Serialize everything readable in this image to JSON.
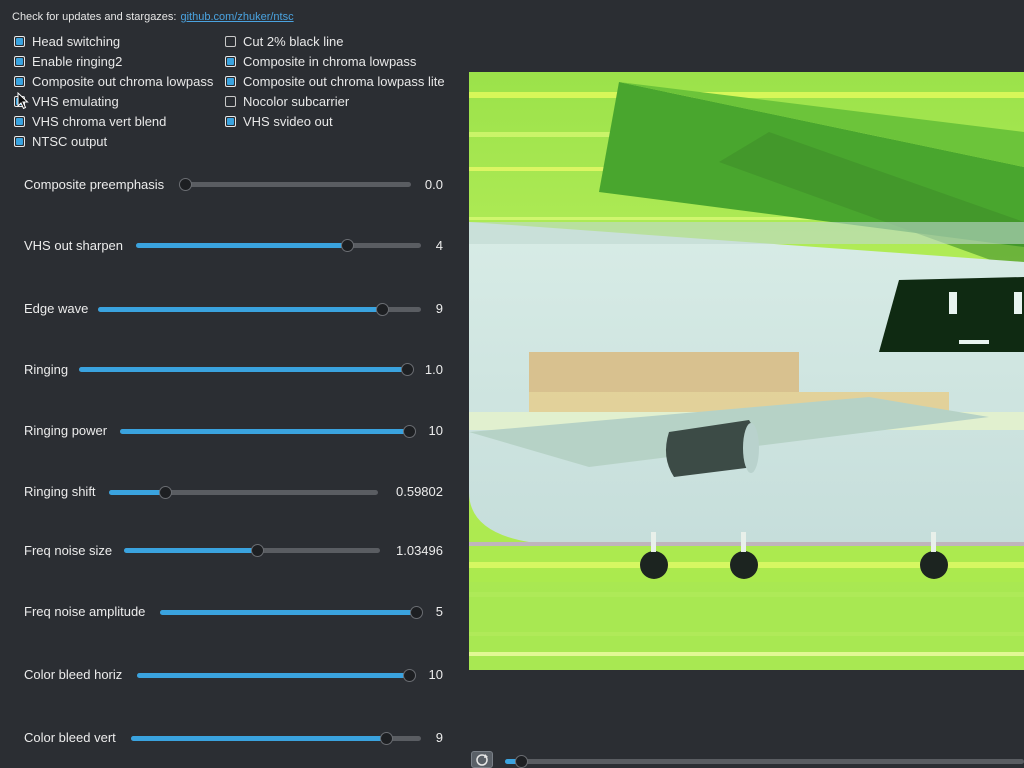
{
  "header": {
    "text": "Check for updates and stargazes:",
    "link": "github.com/zhuker/ntsc"
  },
  "checkboxes": {
    "left": [
      {
        "label": "Head switching",
        "checked": true
      },
      {
        "label": "Enable ringing2",
        "checked": true
      },
      {
        "label": "Composite out chroma lowpass",
        "checked": true
      },
      {
        "label": "VHS emulating",
        "checked": true
      },
      {
        "label": "VHS chroma vert blend",
        "checked": true
      },
      {
        "label": "NTSC output",
        "checked": true
      }
    ],
    "right": [
      {
        "label": "Cut 2% black line",
        "checked": false
      },
      {
        "label": "Composite in chroma lowpass",
        "checked": true
      },
      {
        "label": "Composite out chroma lowpass lite",
        "checked": true
      },
      {
        "label": "Nocolor subcarrier",
        "checked": false
      },
      {
        "label": "VHS svideo out",
        "checked": true
      }
    ]
  },
  "sliders": [
    {
      "label": "Composite preemphasis",
      "value": "0.0",
      "fraction": 0.0
    },
    {
      "label": "VHS out sharpen",
      "value": "4",
      "fraction": 0.74
    },
    {
      "label": "Edge wave",
      "value": "9",
      "fraction": 0.88
    },
    {
      "label": "Ringing",
      "value": "1.0",
      "fraction": 1.0
    },
    {
      "label": "Ringing power",
      "value": "10",
      "fraction": 1.0
    },
    {
      "label": "Ringing shift",
      "value": "0.59802",
      "fraction": 0.21
    },
    {
      "label": "Freq noise size",
      "value": "1.03496",
      "fraction": 0.52
    },
    {
      "label": "Freq noise amplitude",
      "value": "5",
      "fraction": 1.0
    },
    {
      "label": "Color bleed horiz",
      "value": "10",
      "fraction": 1.0
    },
    {
      "label": "Color bleed vert",
      "value": "9",
      "fraction": 0.88
    }
  ],
  "frame_slider": {
    "fraction": 0.02
  },
  "colors": {
    "accent": "#3aa3df",
    "background": "#2b2e33"
  }
}
